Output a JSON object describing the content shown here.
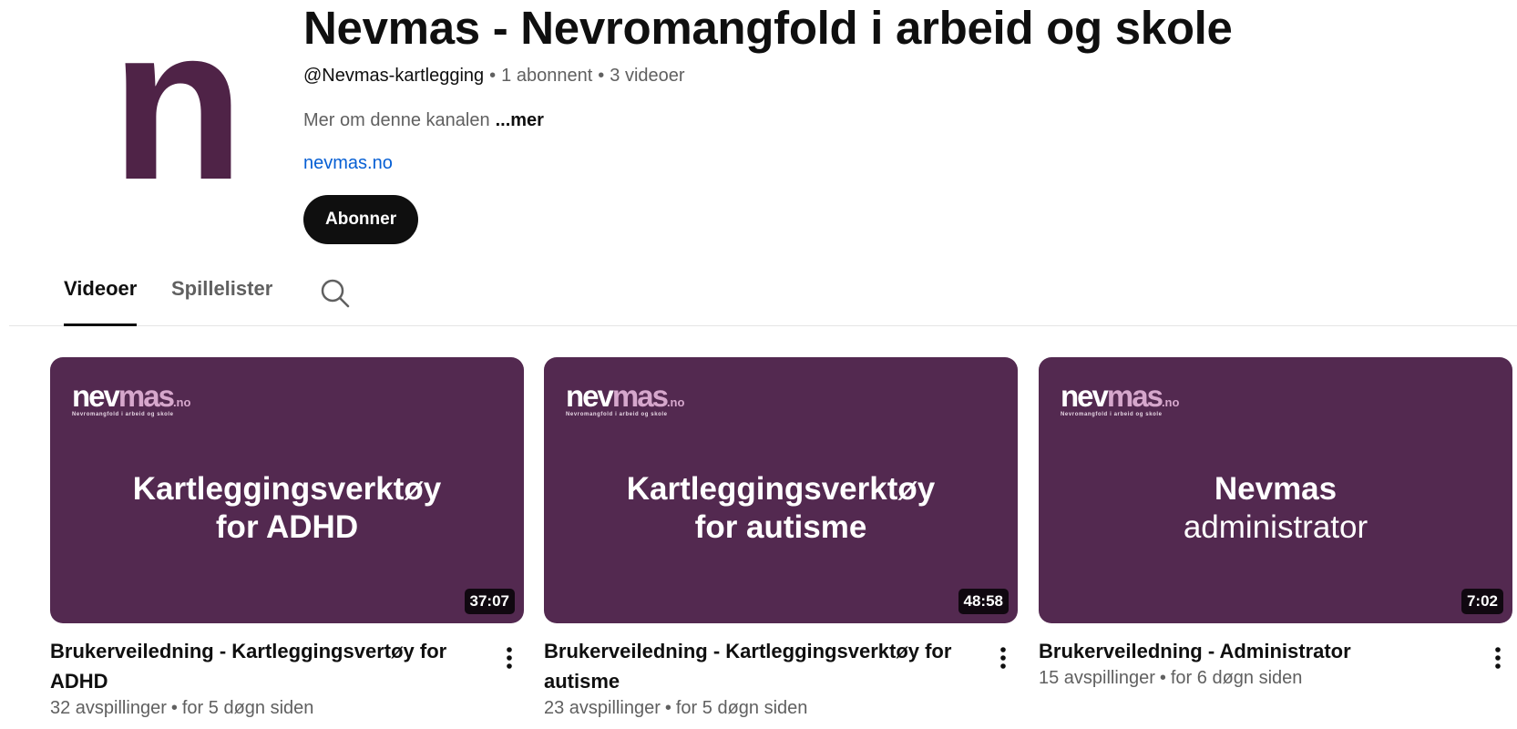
{
  "channel": {
    "avatar_letter": "n",
    "title": "Nevmas - Nevromangfold i arbeid og skole",
    "handle": "@Nevmas-kartlegging",
    "subscribers": "1 abonnent",
    "video_count": "3 videoer",
    "separator": "•",
    "description": "Mer om denne kanalen",
    "more_label": "...mer",
    "link": "nevmas.no",
    "subscribe_label": "Abonner"
  },
  "tabs": [
    {
      "label": "Videoer",
      "active": true
    },
    {
      "label": "Spillelister",
      "active": false
    }
  ],
  "search_icon": "search-icon",
  "thumbnail_logo": {
    "part1": "nev",
    "part2": "mas",
    "tld": ".no",
    "tagline": "Nevromangfold i arbeid og skole"
  },
  "videos": [
    {
      "thumb_line1": "Kartleggingsverktøy",
      "thumb_line2": "for ADHD",
      "duration": "37:07",
      "title": "Brukerveiledning - Kartleggingsvertøy for ADHD",
      "views": "32 avspillinger",
      "age": "for 5 døgn siden"
    },
    {
      "thumb_line1": "Kartleggingsverktøy",
      "thumb_line2": "for autisme",
      "duration": "48:58",
      "title": "Brukerveiledning - Kartleggingsverktøy for autisme",
      "views": "23 avspillinger",
      "age": "for 5 døgn siden"
    },
    {
      "thumb_line1": "Nevmas",
      "thumb_line2": "administrator",
      "duration": "7:02",
      "title": "Brukerveiledning - Administrator",
      "views": "15 avspillinger",
      "age": "for 6 døgn siden"
    }
  ],
  "colors": {
    "brand_purple": "#532950",
    "avatar_purple": "#4f2347",
    "link_blue": "#065fd4",
    "text_primary": "#0f0f0f",
    "text_secondary": "#606060"
  }
}
